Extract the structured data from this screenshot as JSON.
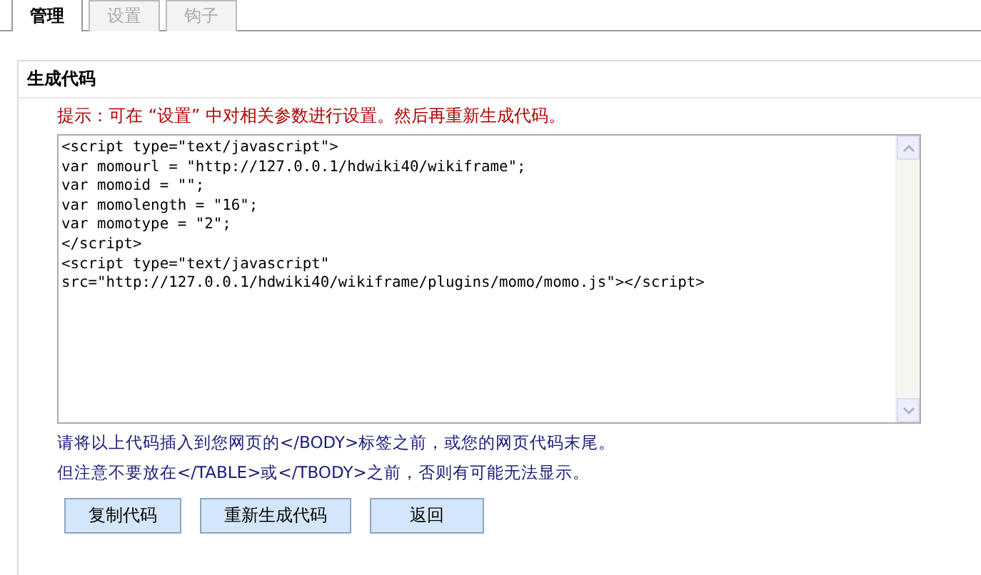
{
  "tabs": [
    {
      "label": "管理",
      "selected": true
    },
    {
      "label": "设置",
      "selected": false
    },
    {
      "label": "钩子",
      "selected": false
    }
  ],
  "panel": {
    "title": "生成代码",
    "hint": "提示：可在 “设置” 中对相关参数进行设置。然后再重新生成代码。",
    "code": "<script type=\"text/javascript\">\nvar momourl = \"http://127.0.0.1/hdwiki40/wikiframe\";\nvar momoid = \"\";\nvar momolength = \"16\";\nvar momotype = \"2\";\n</script>\n<script type=\"text/javascript\"\nsrc=\"http://127.0.0.1/hdwiki40/wikiframe/plugins/momo/momo.js\"></script>",
    "notes": [
      "请将以上代码插入到您网页的</BODY>标签之前，或您的网页代码末尾。",
      "但注意不要放在</TABLE>或</TBODY>之前，否则有可能无法显示。"
    ],
    "buttons": [
      "复制代码",
      "重新生成代码",
      "返回"
    ]
  }
}
